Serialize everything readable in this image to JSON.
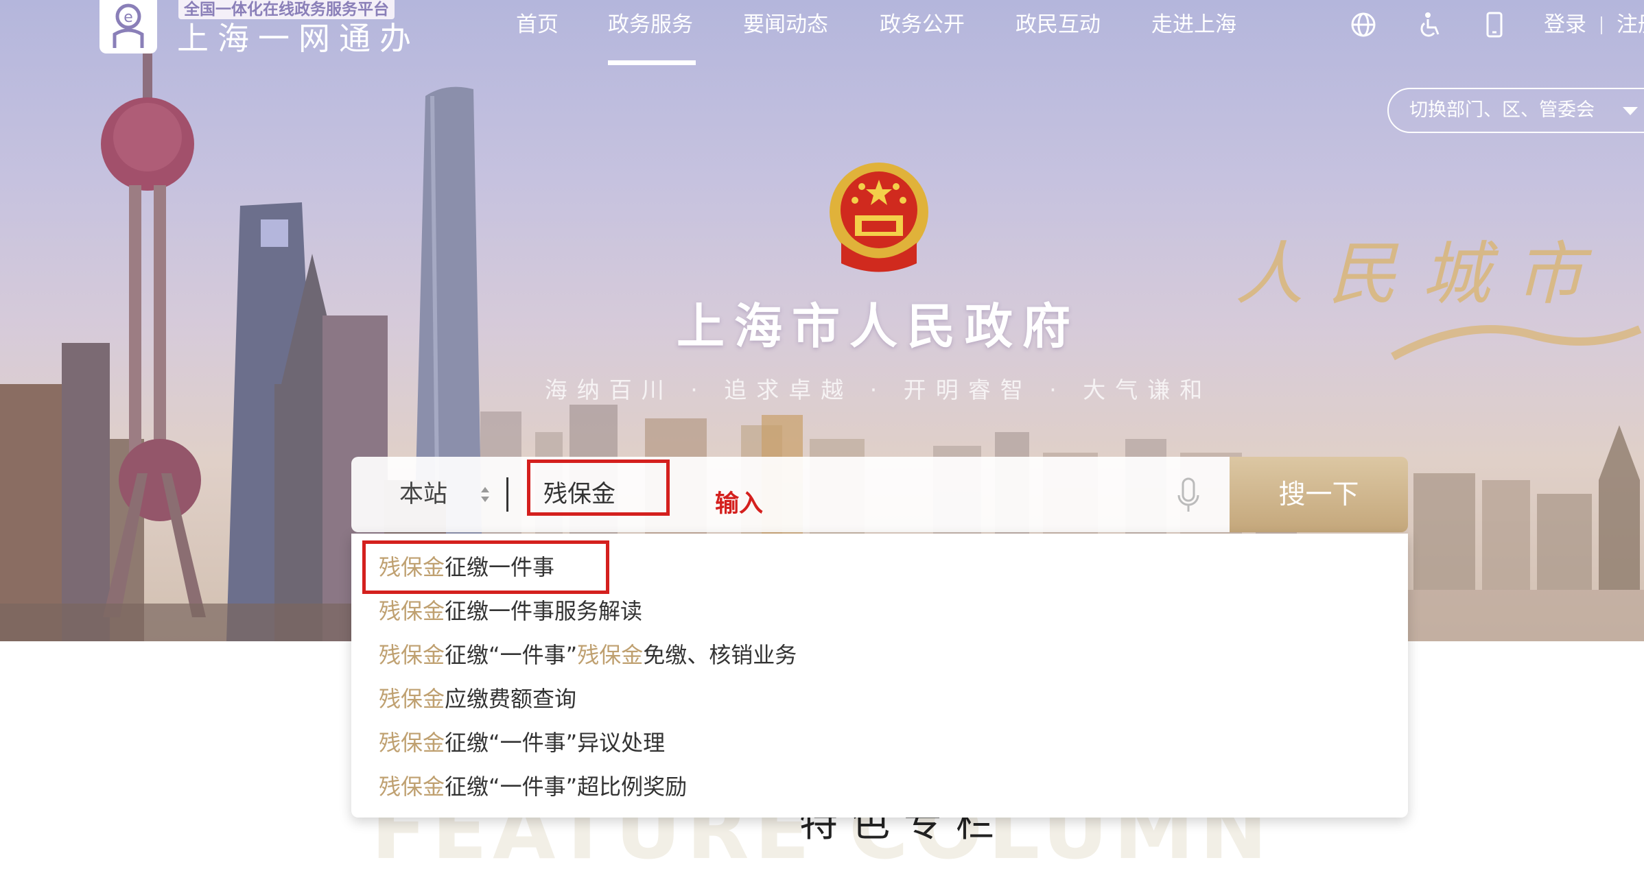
{
  "header": {
    "logo_subtitle": "全国一体化在线政务服务平台",
    "logo_title": "上海一网通办",
    "nav": [
      "首页",
      "政务服务",
      "要闻动态",
      "政务公开",
      "政民互动",
      "走进上海"
    ],
    "active_nav": "政务服务",
    "icons": [
      "globe-icon",
      "accessibility-icon",
      "mobile-icon"
    ],
    "login": "登录",
    "register": "注册",
    "dept_switch": "切换部门、区、管委会"
  },
  "hero": {
    "title": "上海市人民政府",
    "slogan": "海纳百川 · 追求卓越 · 开明睿智 · 大气谦和",
    "calligraphy": "人民城市 人民"
  },
  "search": {
    "scope": "本站",
    "query": "残保金",
    "button": "搜一下",
    "annotation": "输入",
    "suggestions": [
      {
        "prefix": "残保金",
        "rest": "征缴一件事"
      },
      {
        "prefix": "残保金",
        "rest": "征缴一件事服务解读"
      },
      {
        "prefix": "残保金",
        "mid": "征缴“一件事”",
        "prefix2": "残保金",
        "rest": "免缴、核销业务"
      },
      {
        "prefix": "残保金",
        "rest": "应缴费额查询"
      },
      {
        "prefix": "残保金",
        "rest": "征缴“一件事”异议处理"
      },
      {
        "prefix": "残保金",
        "rest": "征缴“一件事”超比例奖励"
      }
    ]
  },
  "feature": {
    "title": "特色专栏",
    "watermark": "FEATURE COLUMN"
  },
  "colors": {
    "highlight": "#bfa070",
    "annotation_red": "#d4201e",
    "search_button": "#c9ad80"
  }
}
